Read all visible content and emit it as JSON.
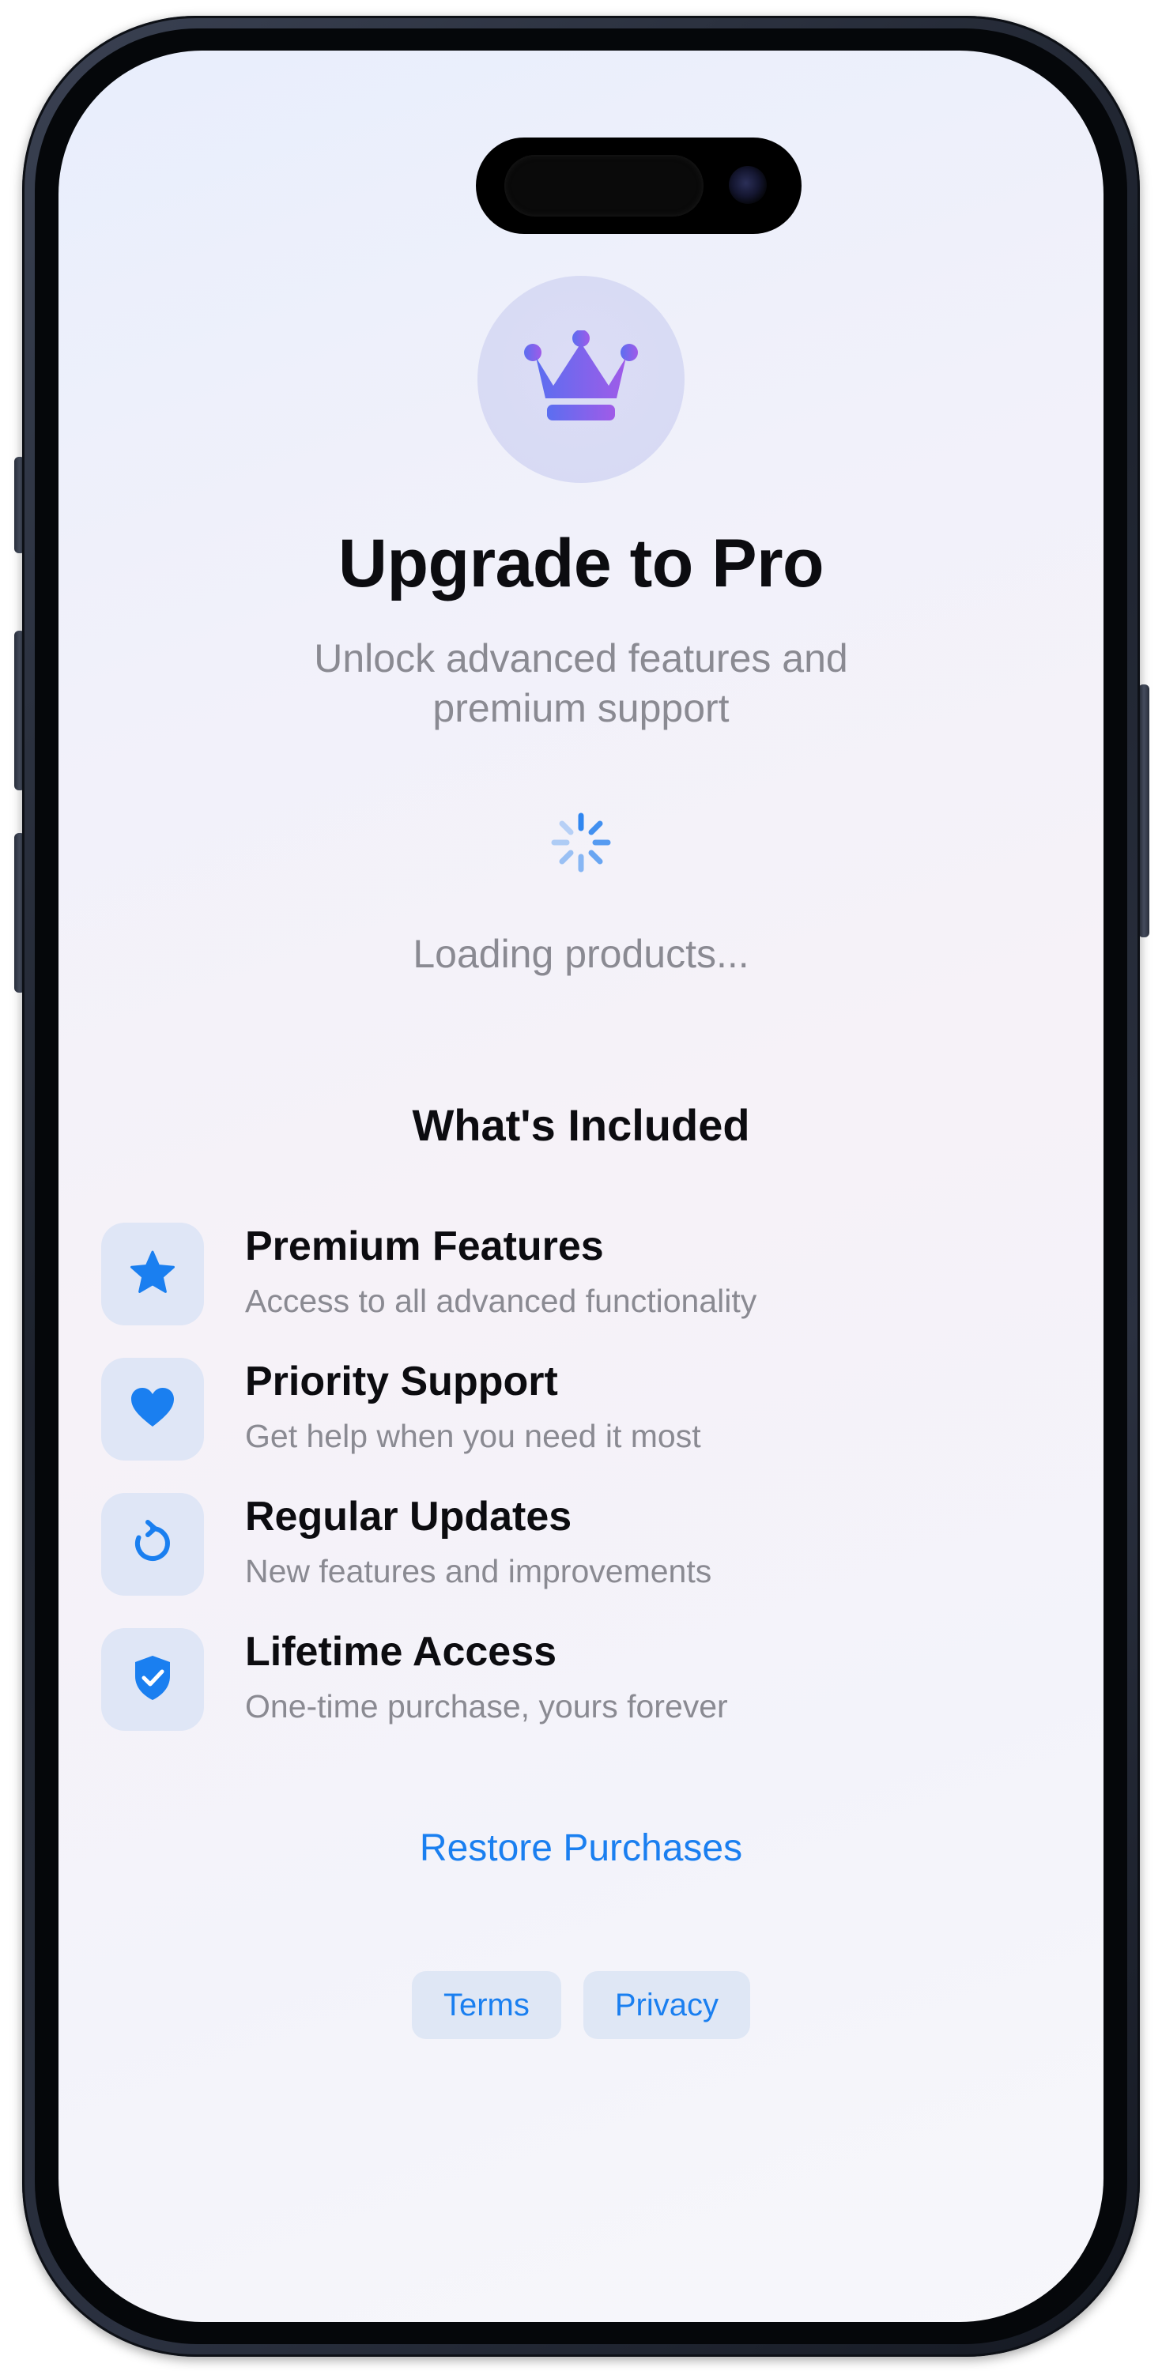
{
  "paywall": {
    "title": "Upgrade to Pro",
    "subtitle_line1": "Unlock advanced features and",
    "subtitle_line2": "premium support",
    "hero_icon": "crown-icon",
    "loading_text": "Loading products...",
    "section_title": "What's Included",
    "features": [
      {
        "icon": "star-icon",
        "title": "Premium Features",
        "description": "Access to all advanced functionality"
      },
      {
        "icon": "heart-icon",
        "title": "Priority Support",
        "description": "Get help when you need it most"
      },
      {
        "icon": "refresh-icon",
        "title": "Regular Updates",
        "description": "New features and improvements"
      },
      {
        "icon": "shield-check-icon",
        "title": "Lifetime Access",
        "description": "One-time purchase, yours forever"
      }
    ],
    "restore_label": "Restore Purchases",
    "terms_label": "Terms",
    "privacy_label": "Privacy"
  },
  "colors": {
    "accent": "#1a7ff0",
    "crown_gradient_start": "#5b6ef0",
    "crown_gradient_end": "#a05be8",
    "text_primary": "#0c0c10",
    "text_secondary": "#8a8a92",
    "icon_tile": "#dfe6f6"
  }
}
